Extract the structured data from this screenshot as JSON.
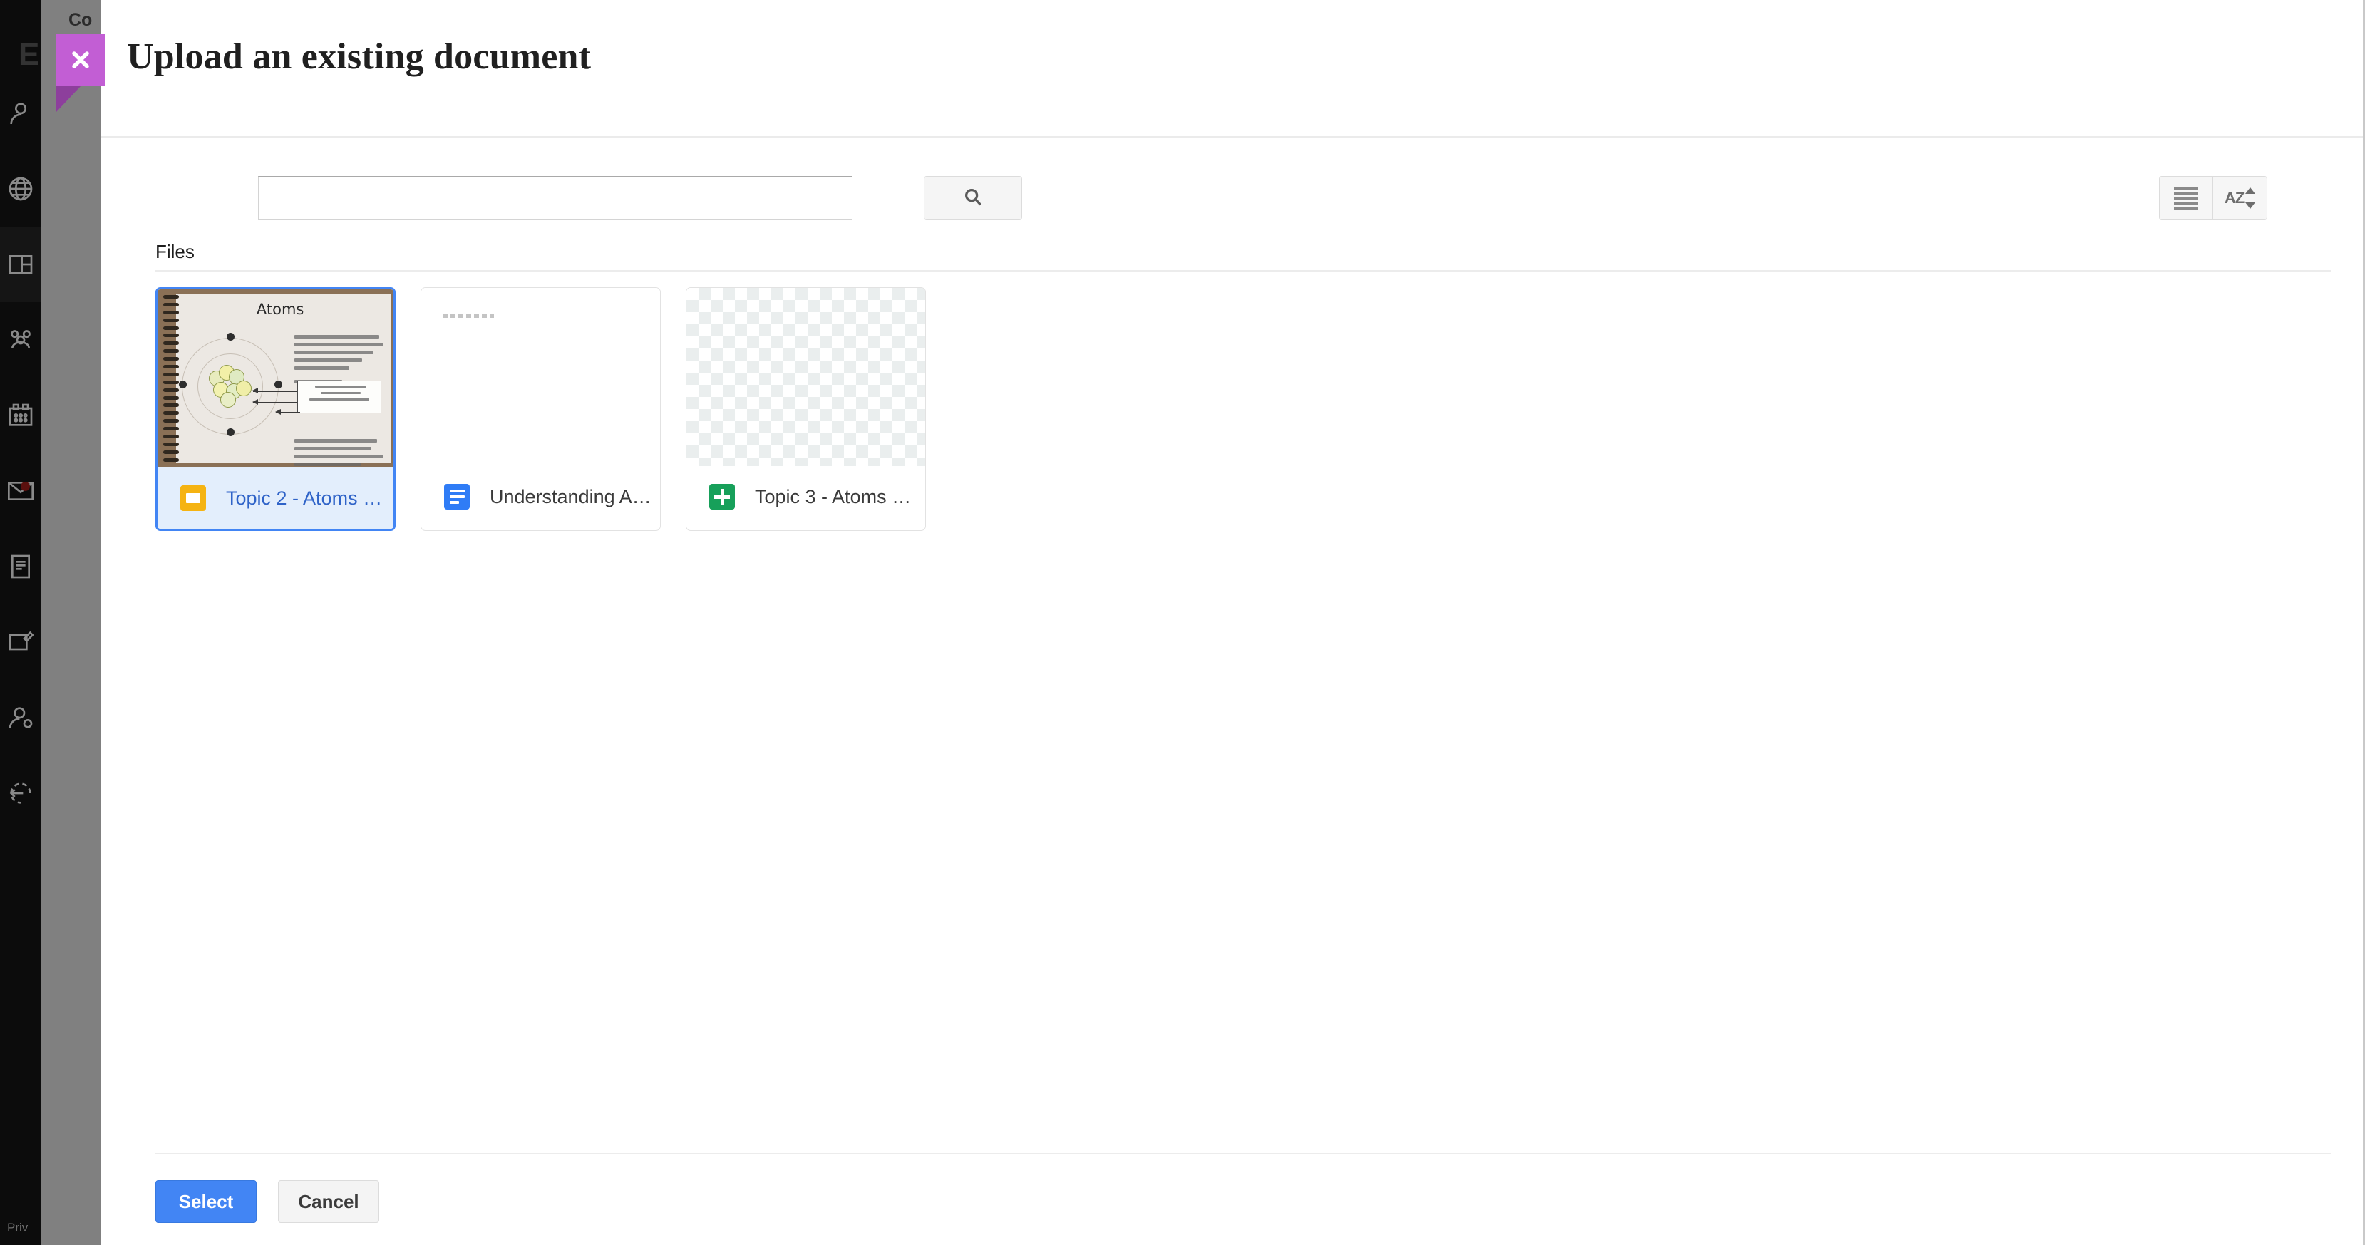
{
  "background_app": {
    "partial_title": "Co",
    "ghost_letter": "E",
    "footer_link": "Priv",
    "rail_items": [
      {
        "name": "person-icon",
        "label": "Profile"
      },
      {
        "name": "globe-icon",
        "label": "Explore"
      },
      {
        "name": "dashboard-icon",
        "label": "Dashboard"
      },
      {
        "name": "people-icon",
        "label": "People"
      },
      {
        "name": "calendar-icon",
        "label": "Calendar"
      },
      {
        "name": "mail-icon",
        "label": "Messages",
        "badge": true
      },
      {
        "name": "document-icon",
        "label": "Documents"
      },
      {
        "name": "compose-icon",
        "label": "Compose"
      },
      {
        "name": "user-settings-icon",
        "label": "Account"
      },
      {
        "name": "undo-icon",
        "label": "Back"
      }
    ]
  },
  "modal": {
    "title": "Upload an existing document",
    "close_label": "Close",
    "toolbar": {
      "search_value": "",
      "search_placeholder": "",
      "search_button_label": "Search",
      "view_list_label": "List view",
      "sort_label": "Sort A-Z"
    },
    "section": {
      "heading": "Files"
    },
    "files": [
      {
        "name": "Topic 2 - Atoms …",
        "icon": "slides-icon",
        "type": "slides",
        "selected": true,
        "thumbnail": "slides-atoms-notebook",
        "thumbnail_title": "Atoms"
      },
      {
        "name": "Understanding A…",
        "icon": "docs-icon",
        "type": "docs",
        "selected": false,
        "thumbnail": "blank-document"
      },
      {
        "name": "Topic 3 - Atoms …",
        "icon": "sheets-icon",
        "type": "sheets",
        "selected": false,
        "thumbnail": "transparent-checkerboard"
      }
    ],
    "footer": {
      "select_label": "Select",
      "cancel_label": "Cancel"
    }
  },
  "colors": {
    "accent_blue": "#4285f4",
    "close_purple": "#c25ed4",
    "close_fold_purple": "#8d3f9c",
    "selected_row_bg": "#e3eefc",
    "selected_text": "#2f63c8",
    "slides_icon": "#f5b312",
    "docs_icon": "#2f7cf6",
    "sheets_icon": "#17a05a",
    "rail_bg": "#0c0c0c",
    "scrim_gray": "#808080"
  }
}
